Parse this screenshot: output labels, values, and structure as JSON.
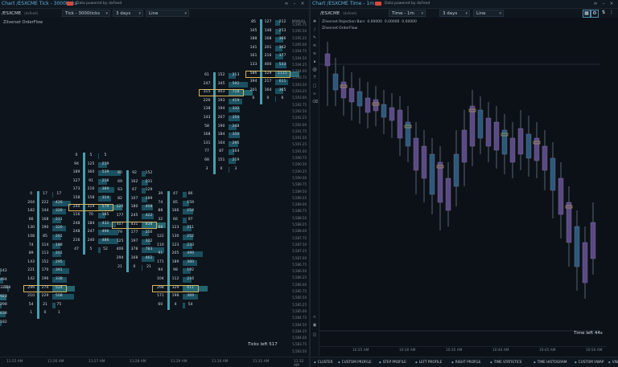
{
  "left": {
    "window_title": "Chart /ESXCME Tick - 3000ticks",
    "powered_by": "Data powered by dxFeed",
    "symbol": "/ESXCME",
    "symbol_tag": "(dxfeed)",
    "timeframe": "Tick - 3000ticks",
    "period": "3 days",
    "chart_type": "Line",
    "overlay_label": "Zilverset OrderFlow",
    "manual_label": "MANUAL",
    "ticks_left": "Ticks left 517",
    "time_labels": [
      "11:25 AM",
      "11:26 AM",
      "11:27 AM",
      "11:28 AM",
      "11:29 AM",
      "11:30 AM",
      "11:31 AM",
      "11:32 AM"
    ],
    "price_labels": [
      "5,595.75",
      "5,595.50",
      "5,595.25",
      "5,595.00",
      "5,594.75",
      "5,594.50",
      "5,594.25",
      "5,594.00",
      "5,593.75",
      "5,593.50",
      "5,593.25",
      "5,593.00",
      "5,592.75",
      "5,592.50",
      "5,592.25",
      "5,592.00",
      "5,591.75",
      "5,591.50",
      "5,591.25",
      "5,591.00",
      "5,590.75",
      "5,590.50",
      "5,590.25",
      "5,590.00",
      "5,589.75",
      "5,589.50",
      "5,589.25",
      "5,589.00",
      "5,588.75",
      "5,588.50",
      "5,588.25",
      "5,588.00",
      "5,587.75",
      "5,587.50",
      "5,587.25",
      "5,587.00",
      "5,586.75",
      "5,586.50",
      "5,586.25",
      "5,586.00",
      "5,585.75",
      "5,585.50",
      "5,585.25",
      "5,585.00",
      "5,584.75",
      "5,584.50",
      "5,584.25",
      "5,584.00",
      "5,583.75",
      "5,583.50"
    ],
    "clusters": [
      {
        "rows": [
          [
            "142"
          ],
          [
            "494"
          ],
          [
            "323",
            "156"
          ],
          [
            "923"
          ],
          [
            "298"
          ],
          [
            "838"
          ],
          [
            "182"
          ]
        ]
      },
      {
        "rows": [
          [
            "0",
            "17",
            "17"
          ],
          [
            "204",
            "222",
            "426"
          ],
          [
            "182",
            "144",
            "326"
          ],
          [
            "66",
            "168",
            "211"
          ],
          [
            "130",
            "190",
            "320"
          ],
          [
            "108",
            "85",
            "201"
          ],
          [
            "74",
            "114",
            "188"
          ],
          [
            "89",
            "113",
            "201"
          ],
          [
            "143",
            "152",
            "295"
          ],
          [
            "221",
            "170",
            "391"
          ],
          [
            "142",
            "196",
            "338"
          ],
          [
            "299",
            "274",
            "524"
          ],
          [
            "210",
            "229",
            "508"
          ],
          [
            "54",
            "21",
            "75"
          ],
          [
            "1",
            "0",
            "1"
          ]
        ]
      },
      {
        "rows": [
          [
            "0",
            "5",
            "5"
          ],
          [
            "94",
            "125",
            "219"
          ],
          [
            "189",
            "360",
            "539"
          ],
          [
            "127",
            "91",
            "218"
          ],
          [
            "173",
            "216",
            "389"
          ],
          [
            "158",
            "158",
            "314"
          ],
          [
            "240",
            "319",
            "579"
          ],
          [
            "116",
            "70",
            "185"
          ],
          [
            "248",
            "184",
            "432"
          ],
          [
            "248",
            "247",
            "496"
          ],
          [
            "216",
            "240",
            "486"
          ],
          [
            "47",
            "5",
            "52"
          ]
        ]
      },
      {
        "rows": [
          [
            "60",
            "92",
            "152"
          ],
          [
            "69",
            "162",
            "231"
          ],
          [
            "63",
            "67",
            "129"
          ],
          [
            "82",
            "107",
            "189"
          ],
          [
            "225",
            "180",
            "408"
          ],
          [
            "177",
            "245",
            "422"
          ],
          [
            "407",
            "431",
            "838"
          ],
          [
            "79",
            "177",
            "256"
          ],
          [
            "125",
            "197",
            "322"
          ],
          [
            "406",
            "378",
            "783"
          ],
          [
            "294",
            "168",
            "462"
          ],
          [
            "21",
            "0",
            "21"
          ]
        ]
      },
      {
        "rows": [
          [
            "39",
            "47",
            "86"
          ],
          [
            "74",
            "85",
            "159"
          ],
          [
            "88",
            "166",
            "254"
          ],
          [
            "32",
            "66",
            "97"
          ],
          [
            "88",
            "123",
            "211"
          ],
          [
            "122",
            "130",
            "252"
          ],
          [
            "110",
            "123",
            "233"
          ],
          [
            "91",
            "205",
            "499"
          ],
          [
            "171",
            "189",
            "360"
          ],
          [
            "94",
            "98",
            "192"
          ],
          [
            "104",
            "112",
            "216"
          ],
          [
            "298",
            "329",
            "611"
          ],
          [
            "171",
            "198",
            "369"
          ],
          [
            "60",
            "4",
            "54"
          ]
        ]
      },
      {
        "rows": [
          [
            "61",
            "152",
            "213"
          ],
          [
            "247",
            "345",
            "592"
          ],
          [
            "315",
            "403",
            "718"
          ],
          [
            "226",
            "193",
            "419"
          ],
          [
            "138",
            "194",
            "332"
          ],
          [
            "143",
            "207",
            "350"
          ],
          [
            "58",
            "190",
            "248"
          ],
          [
            "168",
            "184",
            "350"
          ],
          [
            "131",
            "164",
            "295"
          ],
          [
            "77",
            "87",
            "164"
          ],
          [
            "68",
            "151",
            "219"
          ],
          [
            "3",
            "0",
            "3"
          ]
        ]
      },
      {
        "rows": [
          [
            "85",
            "127",
            "212"
          ],
          [
            "105",
            "148",
            "253"
          ],
          [
            "188",
            "168",
            "366"
          ],
          [
            "141",
            "201",
            "342"
          ],
          [
            "161",
            "216",
            "377"
          ],
          [
            "133",
            "400",
            "533"
          ],
          [
            "586",
            "529",
            "1115"
          ],
          [
            "394",
            "217",
            "611"
          ],
          [
            "201",
            "164",
            "365"
          ],
          [
            "6",
            "0",
            "6"
          ]
        ]
      }
    ]
  },
  "right": {
    "window_title": "Chart /ESXCME Time - 1m",
    "powered_by": "Data powered by dxFeed",
    "symbol": "/ESXCME",
    "symbol_tag": "(dxfeed)",
    "timeframe": "Time - 1m",
    "period": "3 days",
    "chart_type": "Line",
    "overlay_label_1": "Zilverset Rejection Bars",
    "overlay_values": [
      "0.00000",
      "0.00000",
      "0.00000"
    ],
    "overlay_label_2": "Zilverset OrderFlow",
    "time_left": "Time left 44s",
    "time_labels": [
      "10:25 AM",
      "10:30 AM",
      "10:35 AM",
      "10:40 AM",
      "10:45 AM",
      "10:50 AM"
    ],
    "bottom_tabs": [
      "CLUSTER",
      "CUSTOM PROFILE",
      "STEP PROFILE",
      "LEFT PROFILE",
      "RIGHT PROFILE",
      "TIME STATISTICS",
      "TIME HISTOGRAM",
      "CUSTOM VWAP",
      "VWAP"
    ]
  },
  "colors": {
    "accent": "#4fb8c9",
    "bull": "#2b5a79",
    "bear": "#5a4a82",
    "highlight": "#d6b455",
    "cluster_bar": "#1e5f72"
  }
}
